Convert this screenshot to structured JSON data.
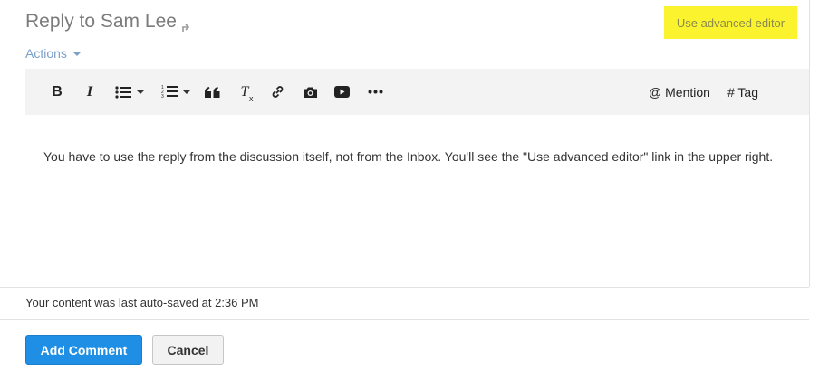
{
  "header": {
    "title": "Reply to Sam Lee",
    "advanced_editor_label": "Use advanced editor",
    "actions_label": "Actions"
  },
  "toolbar": {
    "buttons": [
      {
        "name": "bold",
        "icon": "bold-icon",
        "label": "B"
      },
      {
        "name": "italic",
        "icon": "italic-icon",
        "label": "I"
      },
      {
        "name": "bulleted-list",
        "icon": "bulleted-list-icon",
        "has_dropdown": true
      },
      {
        "name": "numbered-list",
        "icon": "numbered-list-icon",
        "has_dropdown": true
      },
      {
        "name": "blockquote",
        "icon": "quote-icon"
      },
      {
        "name": "clear-formatting",
        "icon": "clear-formatting-icon",
        "label": "T"
      },
      {
        "name": "link",
        "icon": "link-icon"
      },
      {
        "name": "image",
        "icon": "camera-icon"
      },
      {
        "name": "video",
        "icon": "video-play-icon"
      },
      {
        "name": "more",
        "icon": "more-icon"
      }
    ],
    "mention_label": "@ Mention",
    "tag_label": "# Tag"
  },
  "editor": {
    "body": "You have to use the reply from the discussion itself, not from the Inbox. You'll see the \"Use advanced editor\" link in the upper right."
  },
  "status": {
    "autosave_text": "Your content was last auto-saved at 2:36 PM"
  },
  "footer": {
    "submit_label": "Add Comment",
    "cancel_label": "Cancel"
  },
  "colors": {
    "highlight": "#fbf32e",
    "link": "#7aa0c8",
    "primary_button": "#1e8fe4",
    "toolbar_bg": "#f3f3f3"
  }
}
